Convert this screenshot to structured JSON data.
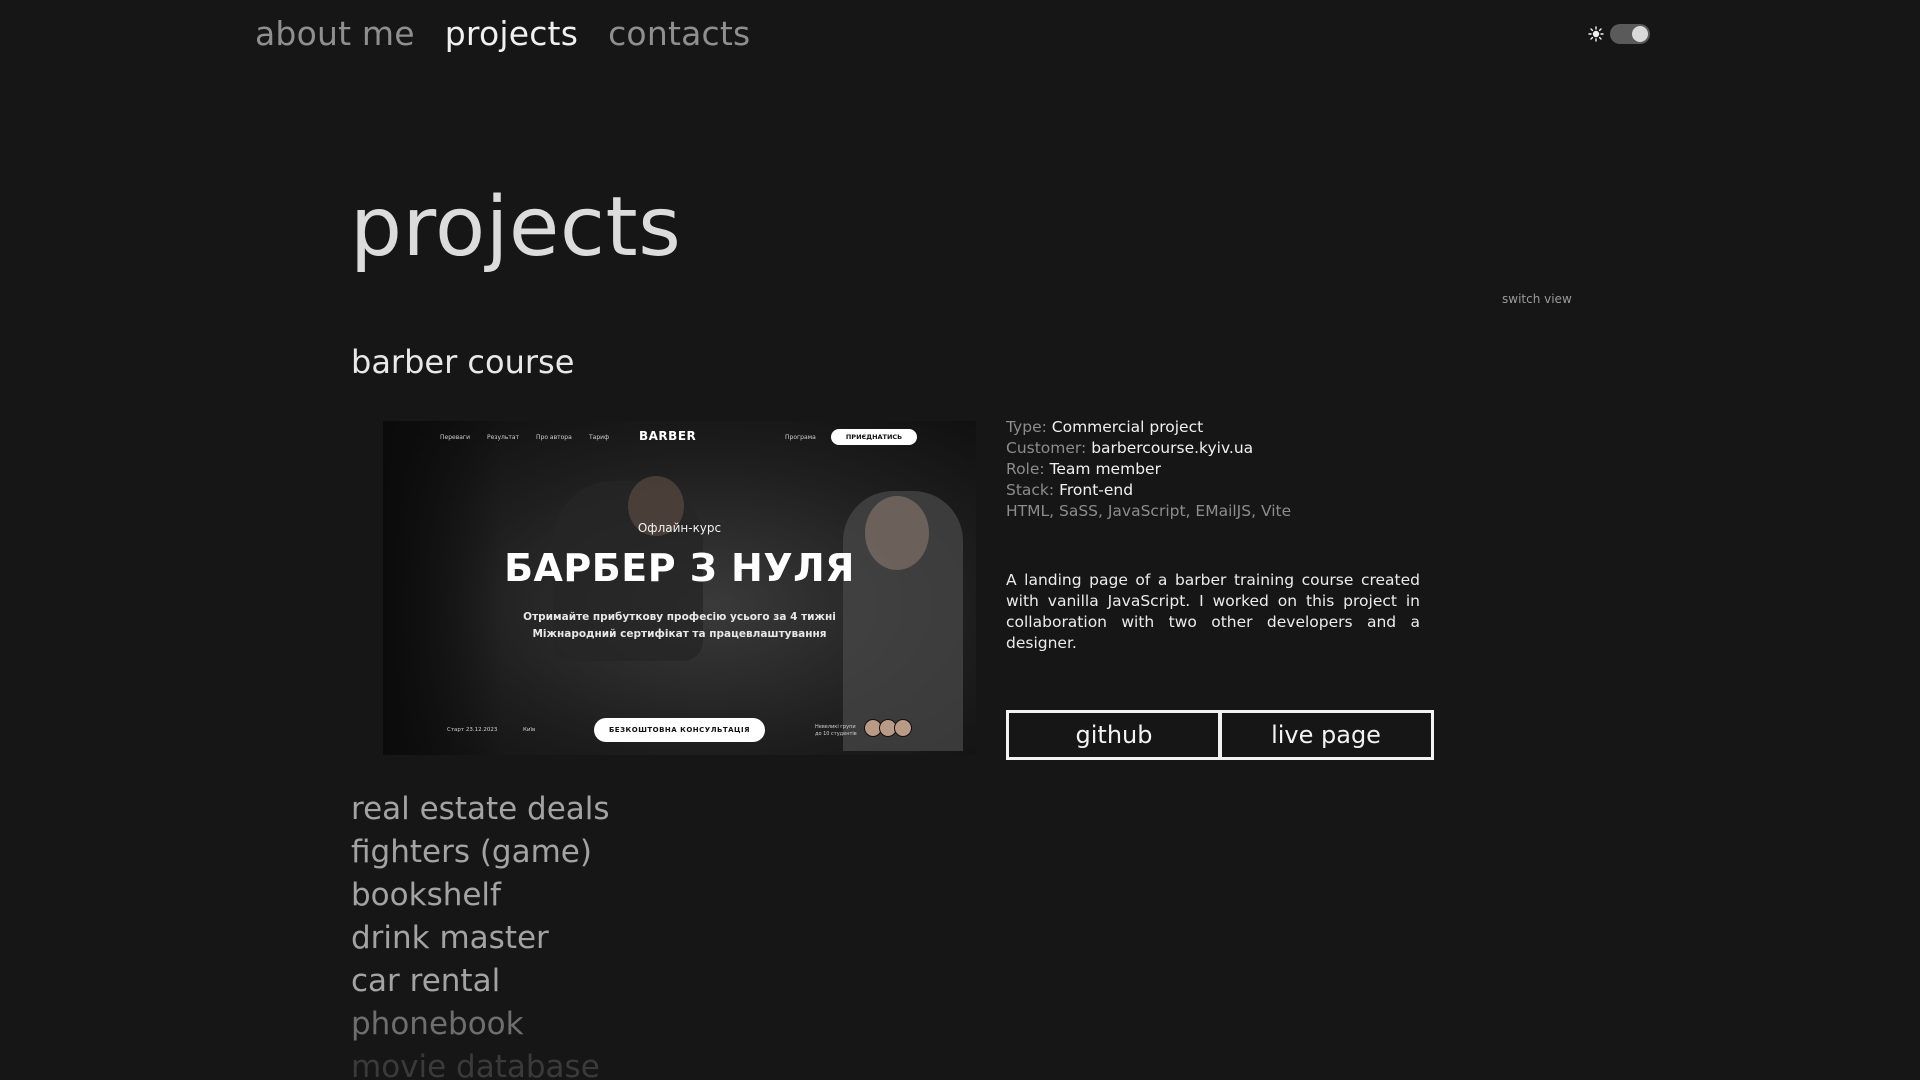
{
  "nav": {
    "items": [
      "about me",
      "projects",
      "contacts"
    ],
    "active": "projects"
  },
  "theme_toggle": {
    "icon": "sun-icon",
    "state": "on"
  },
  "page": {
    "title": "projects",
    "switch_view": "switch view"
  },
  "project": {
    "name": "barber course",
    "preview": {
      "nav_links": [
        "Переваги",
        "Результат",
        "Про автора",
        "Тариф",
        "Програма"
      ],
      "brand": "BARBER",
      "join": "ПРИЄДНАТИСЬ",
      "kicker": "Офлайн-курс",
      "headline": "БАРБЕР З НУЛЯ",
      "sub_line_1": "Отримайте прибуткову професію усього за 4 тижні",
      "sub_line_2": "Міжнародний сертифікат та працевлаштування",
      "cta": "БЕЗКОШТОВНА КОНСУЛЬТАЦІЯ",
      "start": "Старт 23.12.2023",
      "city": "Київ",
      "group_line_1": "Невеликі групи",
      "group_line_2": "до 10 студентів"
    },
    "details": {
      "type_label": "Type:",
      "type": "Commercial project",
      "customer_label": "Customer:",
      "customer": "barbercourse.kyiv.ua",
      "role_label": "Role:",
      "role": "Team member",
      "stack_label": "Stack:",
      "stack": "Front-end",
      "technologies": "HTML, SaSS, JavaScript, EMailJS, Vite"
    },
    "description": "A landing page of a barber training course created with vanilla JavaScript. I worked on this project in collaboration with two other developers and a designer.",
    "buttons": {
      "github": "github",
      "live": "live page"
    }
  },
  "project_list": [
    "real estate deals",
    "fighters (game)",
    "bookshelf",
    "drink master",
    "car rental",
    "phonebook",
    "movie database"
  ]
}
